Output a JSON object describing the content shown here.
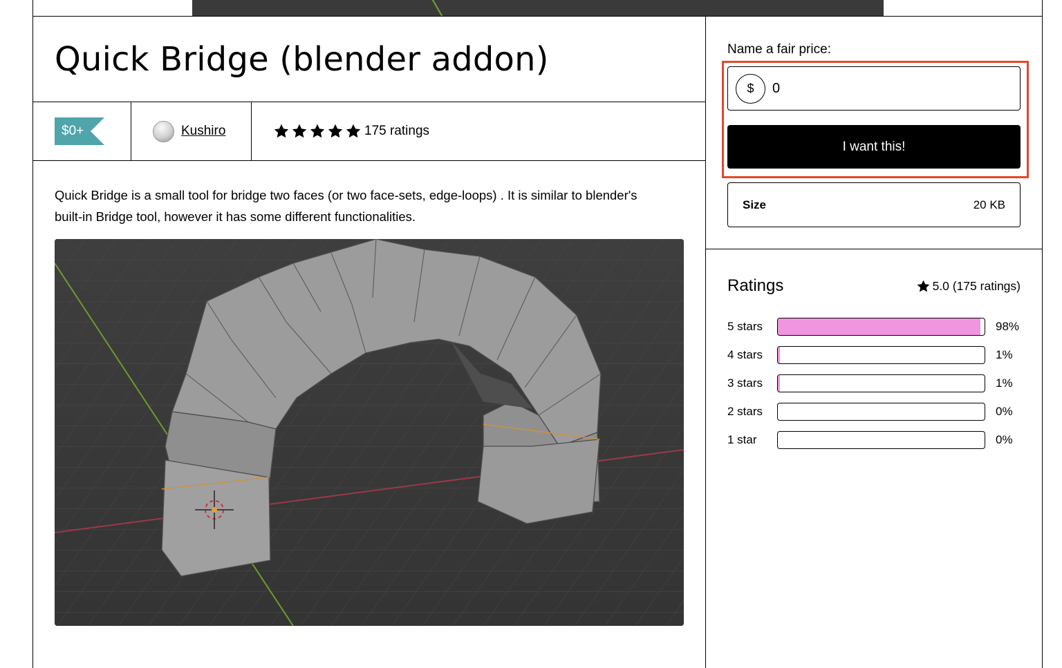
{
  "product": {
    "title": "Quick Bridge (blender addon)",
    "price": "$0+",
    "author": "Kushiro",
    "rating_count_label": "175 ratings",
    "star_count": 5,
    "description": "Quick Bridge is a small tool for bridge two faces (or two face-sets, edge-loops) . It is similar to blender's built-in Bridge tool, however it has some different functionalities."
  },
  "purchase": {
    "price_label": "Name a fair price:",
    "currency_symbol": "$",
    "price_value": "0",
    "buy_label": "I want this!",
    "size_label": "Size",
    "size_value": "20 KB"
  },
  "ratings": {
    "title": "Ratings",
    "summary": "5.0 (175 ratings)",
    "rows": [
      {
        "label": "5 stars",
        "percent_label": "98%",
        "fraction": 0.98
      },
      {
        "label": "4 stars",
        "percent_label": "1%",
        "fraction": 0.01
      },
      {
        "label": "3 stars",
        "percent_label": "1%",
        "fraction": 0.01
      },
      {
        "label": "2 stars",
        "percent_label": "0%",
        "fraction": 0
      },
      {
        "label": "1 star",
        "percent_label": "0%",
        "fraction": 0
      }
    ]
  },
  "colors": {
    "price_badge": "#4fa5a9",
    "rating_bar_fill": "#f095e0",
    "highlight_border": "#e8462b",
    "button_bg": "#000000"
  }
}
